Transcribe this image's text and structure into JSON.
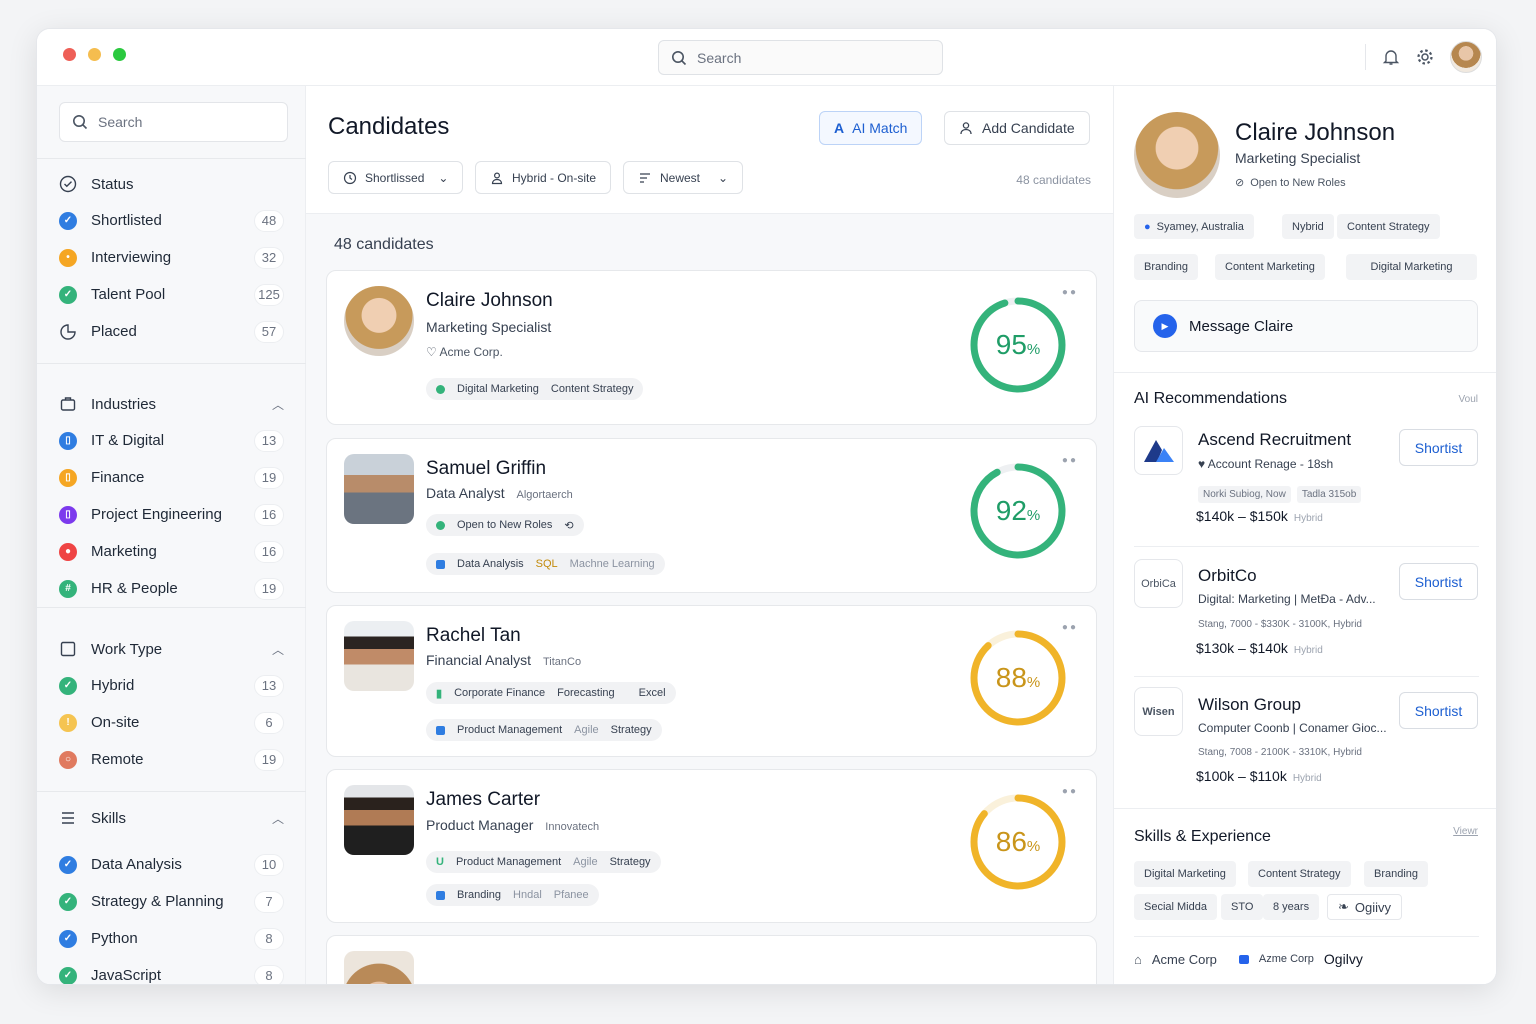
{
  "window": {
    "traffic_colors": [
      "#ee5f57",
      "#f5bd4f",
      "#2bc93f"
    ]
  },
  "topbar": {
    "search_placeholder": "Search"
  },
  "sidebar": {
    "search_placeholder": "Search",
    "status": {
      "title": "Status",
      "items": [
        {
          "label": "Shortlisted",
          "count": "48",
          "color": "#2f7de1",
          "icon": "✓"
        },
        {
          "label": "Interviewing",
          "count": "32",
          "color": "#f5a623",
          "icon": "•"
        },
        {
          "label": "Talent Pool",
          "count": "125",
          "color": "#34b37b",
          "icon": "✓"
        },
        {
          "label": "Placed",
          "count": "57"
        }
      ]
    },
    "industries": {
      "title": "Industries",
      "items": [
        {
          "label": "IT & Digital",
          "count": "13",
          "color": "#2f7de1"
        },
        {
          "label": "Finance",
          "count": "19",
          "color": "#f5a623"
        },
        {
          "label": "Project Engineering",
          "count": "16",
          "color": "#7c3aed"
        },
        {
          "label": "Marketing",
          "count": "16",
          "color": "#ef4444"
        },
        {
          "label": "HR & People",
          "count": "19",
          "color": "#34b37b"
        }
      ]
    },
    "work_type": {
      "title": "Work Type",
      "items": [
        {
          "label": "Hybrid",
          "count": "13",
          "color": "#34b37b"
        },
        {
          "label": "On-site",
          "count": "6",
          "color": "#f5a623"
        },
        {
          "label": "Remote",
          "count": "19",
          "color": "#e07a5f"
        }
      ]
    },
    "skills": {
      "title": "Skills",
      "items": [
        {
          "label": "Data Analysis",
          "count": "10",
          "color": "#2f7de1"
        },
        {
          "label": "Strategy & Planning",
          "count": "7",
          "color": "#34b37b"
        },
        {
          "label": "Python",
          "count": "8",
          "color": "#2f7de1"
        },
        {
          "label": "JavaScript",
          "count": "8",
          "color": "#34b37b"
        }
      ]
    }
  },
  "main": {
    "title": "Candidates",
    "ai_match": "AI Match",
    "add_candidate": "Add Candidate",
    "filters": [
      "Shortlissed",
      "Hybrid - On-site",
      "Newest"
    ],
    "count_right": "48 candidates",
    "count_label": "48 candidates",
    "candidates": [
      {
        "name": "Claire Johnson",
        "role": "Marketing Specialist",
        "company": "Acme Corp.",
        "score": 95,
        "score_color": "#34b37b",
        "chips1": [
          "Digital Marketing",
          "Content Strategy"
        ]
      },
      {
        "name": "Samuel Griffin",
        "role": "Data Analyst",
        "company": "Algortaerch",
        "status": "Open to New Roles",
        "score": 92,
        "score_color": "#34b37b",
        "chips1": [
          "Data Analysis",
          "SQL",
          "Machne Learning"
        ]
      },
      {
        "name": "Rachel Tan",
        "role": "Financial Analyst",
        "company": "TitanCo",
        "score": 88,
        "score_color": "#f0b429",
        "chips1": [
          "Corporate Finance",
          "Forecasting",
          "Excel"
        ],
        "chips2": [
          "Product Management",
          "Agile",
          "Strategy"
        ]
      },
      {
        "name": "James Carter",
        "role": "Product Manager",
        "company": "Innovatech",
        "score": 86,
        "score_color": "#f0b429",
        "chips1": [
          "Product Management",
          "Agile",
          "Strategy"
        ],
        "chips2": [
          "Branding",
          "Hndal",
          "Pfanee"
        ]
      }
    ]
  },
  "profile": {
    "name": "Claire Johnson",
    "role": "Marketing Specialist",
    "status": "Open to New Roles",
    "tags_row1": [
      "Syamey, Australia",
      "Nybrid",
      "Content Strategy"
    ],
    "tags_row2": [
      "Branding",
      "Content Marketing",
      "Digital Marketing"
    ],
    "message": "Message Claire",
    "ai_title": "AI Recommendations",
    "ai_link": "Voul",
    "recs": [
      {
        "name": "Ascend Recruitment",
        "sub": "Account Renage - 18sh",
        "meta1": "Norki Subiog, Now",
        "meta2": "Tadla 315ob",
        "salary": "$140k – $150k",
        "mode": "Hybrid",
        "btn": "Shortist"
      },
      {
        "name": "OrbitCo",
        "logo": "OrbiCa",
        "sub": "Digital: Marketing | MetÐa - Adv...",
        "meta1": "Stang, 7000 - $330K - 3100K, Hybrid",
        "salary": "$130k – $140k",
        "mode": "Hybrid",
        "btn": "Shortist"
      },
      {
        "name": "Wilson Group",
        "logo": "Wisen",
        "sub": "Computer Coonb | Conamer Gioc...",
        "meta1": "Stang, 7008 - 2100K - 3310K, Hybrid",
        "salary": "$100k – $110k",
        "mode": "Hybrid",
        "btn": "Shortist"
      }
    ],
    "skills_title": "Skills & Experience",
    "skills_link": "Viewr",
    "skills_row1": [
      "Digital Marketing",
      "Content Strategy",
      "Branding"
    ],
    "skills_row2": [
      "Secial Midda",
      "STO",
      "8 years",
      "Ogiivy"
    ],
    "footer": [
      "Acme Corp",
      "Azme Corp",
      "Ogilvy"
    ]
  }
}
